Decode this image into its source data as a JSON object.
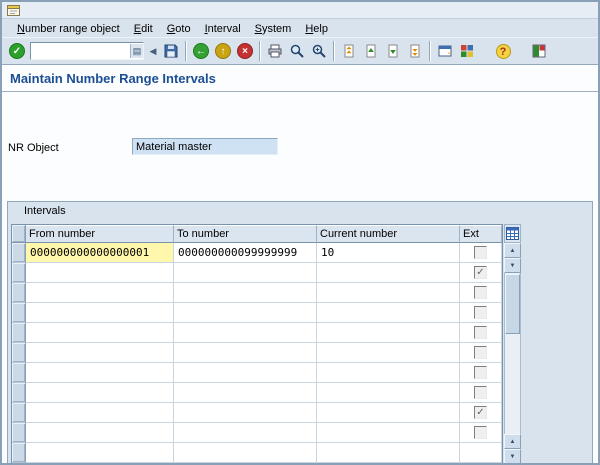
{
  "menu_bar": {
    "items": [
      "Number range object",
      "Edit",
      "Goto",
      "Interval",
      "System",
      "Help"
    ]
  },
  "toolbar": {
    "command_field": {
      "value": "",
      "placeholder": ""
    },
    "buttons": [
      {
        "name": "enter",
        "icon": "green-check-icon"
      },
      {
        "name": "collapse-command",
        "icon": "left-triangle-icon"
      },
      {
        "name": "save",
        "icon": "floppy-disk-icon"
      },
      {
        "name": "back",
        "icon": "green-left-arrow-icon"
      },
      {
        "name": "exit",
        "icon": "yellow-up-arrow-icon"
      },
      {
        "name": "cancel",
        "icon": "red-x-icon"
      },
      {
        "name": "print",
        "icon": "printer-icon"
      },
      {
        "name": "find",
        "icon": "magnifier-icon"
      },
      {
        "name": "find-next",
        "icon": "magnifier-plus-icon"
      },
      {
        "name": "first-page",
        "icon": "page-first-icon"
      },
      {
        "name": "page-up",
        "icon": "page-up-icon"
      },
      {
        "name": "page-down",
        "icon": "page-down-icon"
      },
      {
        "name": "last-page",
        "icon": "page-last-icon"
      },
      {
        "name": "new-session",
        "icon": "window-icon"
      },
      {
        "name": "shortcut",
        "icon": "desktop-shortcut-icon"
      },
      {
        "name": "help",
        "icon": "question-mark-icon"
      },
      {
        "name": "customize-layout",
        "icon": "layout-customize-icon"
      }
    ]
  },
  "page": {
    "title": "Maintain Number Range Intervals"
  },
  "form": {
    "nr_object": {
      "label": "NR Object",
      "value": "Material master"
    }
  },
  "intervals_table": {
    "group_title": "Intervals",
    "columns": {
      "from": "From number",
      "to": "To number",
      "current": "Current number",
      "ext": "Ext"
    },
    "rows": [
      {
        "from": "000000000000000001",
        "to": "000000000099999999",
        "current": "10",
        "from_highlight": true,
        "has_checkbox": true,
        "ext_checked": false
      },
      {
        "from": "",
        "to": "",
        "current": "",
        "has_checkbox": true,
        "ext_checked": true
      },
      {
        "from": "",
        "to": "",
        "current": "",
        "has_checkbox": true,
        "ext_checked": false
      },
      {
        "from": "",
        "to": "",
        "current": "",
        "has_checkbox": true,
        "ext_checked": false
      },
      {
        "from": "",
        "to": "",
        "current": "",
        "has_checkbox": true,
        "ext_checked": false
      },
      {
        "from": "",
        "to": "",
        "current": "",
        "has_checkbox": true,
        "ext_checked": false
      },
      {
        "from": "",
        "to": "",
        "current": "",
        "has_checkbox": true,
        "ext_checked": false
      },
      {
        "from": "",
        "to": "",
        "current": "",
        "has_checkbox": true,
        "ext_checked": false
      },
      {
        "from": "",
        "to": "",
        "current": "",
        "has_checkbox": true,
        "ext_checked": true
      },
      {
        "from": "",
        "to": "",
        "current": "",
        "has_checkbox": true,
        "ext_checked": false
      },
      {
        "from": "",
        "to": "",
        "current": "",
        "has_checkbox": false,
        "ext_checked": false
      }
    ]
  },
  "colors": {
    "title_text": "#1c4e94",
    "highlight_cell": "#fff8ac",
    "display_field_bg": "#cfe2f4",
    "group_bg": "#d8e3ee",
    "chrome_bg": "#d9e3ed"
  }
}
